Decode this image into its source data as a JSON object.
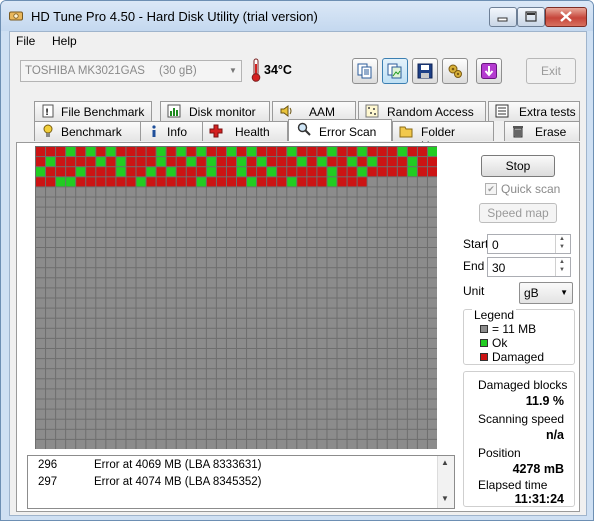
{
  "window": {
    "title": "HD Tune Pro 4.50 - Hard Disk Utility (trial version)"
  },
  "menu": {
    "file": "File",
    "help": "Help"
  },
  "toolbar": {
    "drive_name": "TOSHIBA MK3021GAS",
    "drive_capacity": "(30 gB)",
    "temperature": "34°C",
    "exit_label": "Exit",
    "icons": [
      "copy-text-icon",
      "copy-screenshot-icon",
      "save-icon",
      "options-icon",
      "download-icon"
    ]
  },
  "tabs": {
    "row1": [
      "File Benchmark",
      "Disk monitor",
      "AAM",
      "Random Access",
      "Extra tests"
    ],
    "row2": [
      "Benchmark",
      "Info",
      "Health",
      "Error Scan",
      "Folder Usage",
      "Erase"
    ],
    "active": "Error Scan"
  },
  "scan": {
    "columns": 40,
    "rows": 30,
    "scanned_blocks": 153,
    "damaged_cells": [
      0,
      1,
      2,
      4,
      6,
      8,
      9,
      10,
      11,
      13,
      15,
      17,
      18,
      20,
      22,
      23,
      24,
      26,
      27,
      28,
      30,
      31,
      33,
      34,
      35,
      37,
      38,
      40,
      42,
      43,
      44,
      45,
      47,
      49,
      50,
      51,
      53,
      54,
      56,
      58,
      59,
      61,
      63,
      64,
      65,
      67,
      69,
      70,
      72,
      74,
      75,
      76,
      78,
      79,
      81,
      82,
      83,
      85,
      86,
      87,
      89,
      90,
      92,
      94,
      95,
      96,
      98,
      99,
      101,
      102,
      104,
      105,
      106,
      107,
      108,
      110,
      111,
      113,
      114,
      115,
      116,
      118,
      119,
      120,
      121,
      124,
      125,
      126,
      127,
      128,
      129,
      131,
      132,
      133,
      134,
      135,
      137,
      138,
      139,
      140,
      142,
      143,
      144,
      146,
      147,
      148,
      150,
      151,
      152
    ],
    "colors": {
      "unscanned": "#8c8c8c",
      "ok": "#22cc22",
      "damaged": "#cc1414",
      "grid_line": "#6e6e6e"
    }
  },
  "log": {
    "rows": [
      {
        "num": "296",
        "text": "Error at 4069 MB (LBA 8333631)"
      },
      {
        "num": "297",
        "text": "Error at 4074 MB (LBA 8345352)"
      }
    ]
  },
  "controls": {
    "stop_label": "Stop",
    "quick_scan_label": "Quick scan",
    "quick_scan_checked": true,
    "speed_map_label": "Speed map",
    "start_label": "Start",
    "start_value": "0",
    "end_label": "End",
    "end_value": "30",
    "unit_label": "Unit",
    "unit_value": "gB"
  },
  "legend": {
    "title": "Legend",
    "block_size": "= 11 MB",
    "ok": "Ok",
    "damaged": "Damaged"
  },
  "stats": {
    "damaged_blocks_label": "Damaged blocks",
    "damaged_blocks_value": "11.9 %",
    "scanning_speed_label": "Scanning speed",
    "scanning_speed_value": "n/a",
    "position_label": "Position",
    "position_value": "4278 mB",
    "elapsed_label": "Elapsed time",
    "elapsed_value": "11:31:24"
  }
}
